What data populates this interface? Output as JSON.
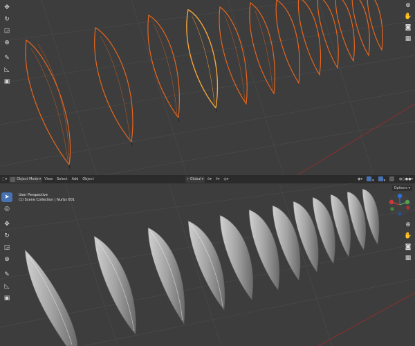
{
  "header": {
    "mode_label": "Object Mode",
    "menu_items": [
      "View",
      "Select",
      "Add",
      "Object"
    ],
    "transform_orientation": "Global",
    "options_label": "Options"
  },
  "overlay": {
    "view_name": "User Perspective",
    "collection_info": "(1) Scene Collection | Nurbs 001"
  },
  "icons": {
    "cursor": "cursor-arrow-icon",
    "move": "move-icon",
    "rotate": "rotate-icon",
    "scale": "scale-icon",
    "transform": "transform-icon",
    "annotate": "annotate-icon",
    "measure": "measure-icon",
    "add_cube": "add-cube-icon",
    "zoom": "zoom-icon",
    "pan": "pan-hand-icon",
    "camera": "camera-icon",
    "grid": "grid-icon"
  },
  "colors": {
    "viewport_bg": "#3d3d3d",
    "wire_selected": "#e8661c",
    "wire_active": "#f6a53a",
    "solid_surface": "#9a9a9a",
    "grid_x_axis": "#8a2f2f",
    "header_bg": "#2b2b2b",
    "active_tool": "#4772b3"
  }
}
